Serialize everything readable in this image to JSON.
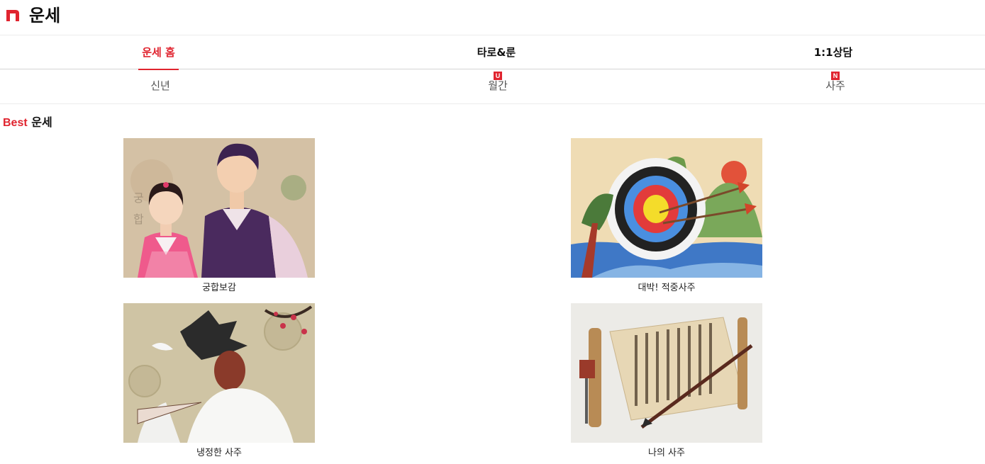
{
  "header": {
    "title": "운세",
    "logo_icon": "n-logo-icon",
    "brand_color": "#e0242f"
  },
  "tabs": [
    {
      "label": "운세 홈",
      "active": true
    },
    {
      "label": "타로&룬",
      "active": false
    },
    {
      "label": "1:1상담",
      "active": false
    }
  ],
  "subtabs": [
    {
      "label": "신년",
      "badge": ""
    },
    {
      "label": "월간",
      "badge": "U"
    },
    {
      "label": "사주",
      "badge": "N"
    }
  ],
  "section": {
    "highlight": "Best",
    "title": "운세"
  },
  "cards": [
    {
      "caption": "궁합보감",
      "image": "hanbok-couple-illustration"
    },
    {
      "caption": "대박! 적중사주",
      "image": "archery-target-illustration"
    },
    {
      "caption": "냉정한 사주",
      "image": "masked-dancer-illustration"
    },
    {
      "caption": "나의 사주",
      "image": "scroll-and-brush-illustration"
    }
  ]
}
